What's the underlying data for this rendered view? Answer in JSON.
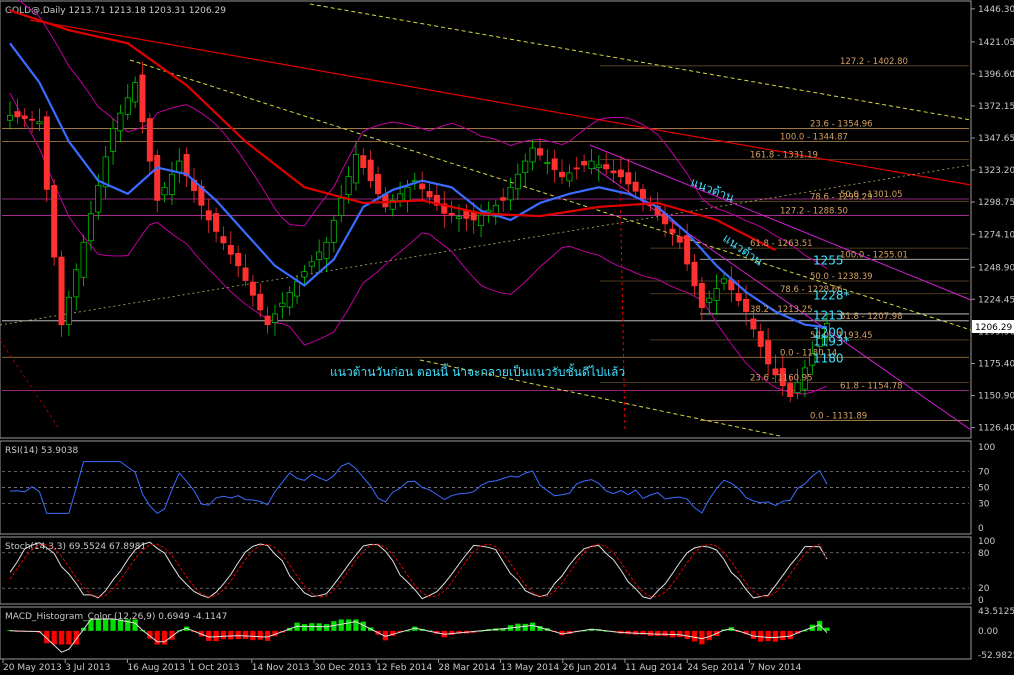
{
  "window": {
    "main_label": "GOLD@,Daily  1213.71 1213.18 1203.31 1206.29",
    "rsi_label": "RSI(14) 53.9038",
    "stoch_label": "Stoch(14,3,3) 69.5524 67.8981",
    "macd_label": "MACD_Histogram_Color (12,26,9) 0.6949 -4.1147"
  },
  "colors": {
    "background": "#000000",
    "axis": "#9a9a9a",
    "text": "#c8c8c8",
    "candle_up": "#00d000",
    "candle_down": "#ff3030",
    "ma_blue": "#3a6cff",
    "ma_red": "#e00000",
    "bollinger": "#c000a0",
    "fib_orange": "#d4a060",
    "trend_yellow": "#d8d840",
    "annotation_cyan": "#40e0ff",
    "hist_pos": "#00e000",
    "hist_neg": "#ff0000"
  },
  "chart_data": {
    "type": "line",
    "title": "GOLD@,Daily",
    "price_axis_ticks": [
      "1446.30",
      "1421.05",
      "1396.60",
      "1372.15",
      "1347.65",
      "1323.20",
      "1298.75",
      "1274.10",
      "1248.90",
      "1224.45",
      "1199.90",
      "1175.40",
      "1150.90",
      "1126.40"
    ],
    "current_price": "1206.29",
    "ylim": [
      1120,
      1450
    ],
    "x_dates": [
      "20 May 2013",
      "3 Jul 2013",
      "16 Aug 2013",
      "1 Oct 2013",
      "14 Nov 2013",
      "30 Dec 2013",
      "12 Feb 2014",
      "28 Mar 2014",
      "13 May 2014",
      "26 Jun 2014",
      "11 Aug 2014",
      "24 Sep 2014",
      "7 Nov 2014"
    ],
    "close_path": [
      {
        "x": 0,
        "y": 1365
      },
      {
        "x": 4,
        "y": 1360
      },
      {
        "x": 7,
        "y": 1205
      },
      {
        "x": 10,
        "y": 1268
      },
      {
        "x": 14,
        "y": 1355
      },
      {
        "x": 17,
        "y": 1390
      },
      {
        "x": 20,
        "y": 1300
      },
      {
        "x": 23,
        "y": 1330
      },
      {
        "x": 27,
        "y": 1285
      },
      {
        "x": 31,
        "y": 1250
      },
      {
        "x": 35,
        "y": 1205
      },
      {
        "x": 39,
        "y": 1238
      },
      {
        "x": 43,
        "y": 1268
      },
      {
        "x": 47,
        "y": 1335
      },
      {
        "x": 51,
        "y": 1295
      },
      {
        "x": 55,
        "y": 1315
      },
      {
        "x": 59,
        "y": 1290
      },
      {
        "x": 63,
        "y": 1285
      },
      {
        "x": 67,
        "y": 1300
      },
      {
        "x": 71,
        "y": 1340
      },
      {
        "x": 75,
        "y": 1318
      },
      {
        "x": 79,
        "y": 1330
      },
      {
        "x": 83,
        "y": 1318
      },
      {
        "x": 87,
        "y": 1296
      },
      {
        "x": 91,
        "y": 1268
      },
      {
        "x": 94,
        "y": 1218
      },
      {
        "x": 97,
        "y": 1240
      },
      {
        "x": 100,
        "y": 1215
      },
      {
        "x": 103,
        "y": 1175
      },
      {
        "x": 106,
        "y": 1150
      },
      {
        "x": 109,
        "y": 1183
      },
      {
        "x": 111,
        "y": 1206
      }
    ],
    "ma_blue_path": [
      {
        "x": 0,
        "y": 1420
      },
      {
        "x": 4,
        "y": 1390
      },
      {
        "x": 8,
        "y": 1345
      },
      {
        "x": 12,
        "y": 1315
      },
      {
        "x": 16,
        "y": 1305
      },
      {
        "x": 20,
        "y": 1325
      },
      {
        "x": 24,
        "y": 1320
      },
      {
        "x": 28,
        "y": 1300
      },
      {
        "x": 32,
        "y": 1275
      },
      {
        "x": 36,
        "y": 1250
      },
      {
        "x": 40,
        "y": 1235
      },
      {
        "x": 44,
        "y": 1255
      },
      {
        "x": 48,
        "y": 1295
      },
      {
        "x": 52,
        "y": 1308
      },
      {
        "x": 56,
        "y": 1315
      },
      {
        "x": 60,
        "y": 1310
      },
      {
        "x": 64,
        "y": 1292
      },
      {
        "x": 68,
        "y": 1285
      },
      {
        "x": 72,
        "y": 1298
      },
      {
        "x": 76,
        "y": 1305
      },
      {
        "x": 80,
        "y": 1310
      },
      {
        "x": 84,
        "y": 1305
      },
      {
        "x": 88,
        "y": 1295
      },
      {
        "x": 92,
        "y": 1275
      },
      {
        "x": 96,
        "y": 1250
      },
      {
        "x": 100,
        "y": 1230
      },
      {
        "x": 104,
        "y": 1215
      },
      {
        "x": 108,
        "y": 1205
      },
      {
        "x": 111,
        "y": 1203
      }
    ],
    "ma_red_path": [
      {
        "x": 0,
        "y": 1445
      },
      {
        "x": 8,
        "y": 1430
      },
      {
        "x": 16,
        "y": 1420
      },
      {
        "x": 24,
        "y": 1388
      },
      {
        "x": 32,
        "y": 1345
      },
      {
        "x": 40,
        "y": 1310
      },
      {
        "x": 48,
        "y": 1298
      },
      {
        "x": 56,
        "y": 1300
      },
      {
        "x": 64,
        "y": 1290
      },
      {
        "x": 72,
        "y": 1288
      },
      {
        "x": 80,
        "y": 1295
      },
      {
        "x": 88,
        "y": 1298
      },
      {
        "x": 96,
        "y": 1285
      },
      {
        "x": 104,
        "y": 1262
      }
    ],
    "fib_levels": [
      {
        "label": "127.2 - 1402.80",
        "price": 1402.8
      },
      {
        "label": "23.6 - 1354.96",
        "price": 1354.96
      },
      {
        "label": "100.0 - 1344.87",
        "price": 1344.87
      },
      {
        "label": "161.8 - 1331.19",
        "price": 1331.19
      },
      {
        "label": "50.0 - 1301.05",
        "price": 1301.05
      },
      {
        "label": "78.6 - 1299.29",
        "price": 1299.29
      },
      {
        "label": "127.2 - 1288.50",
        "price": 1288.5
      },
      {
        "label": "61.8 - 1263.51",
        "price": 1263.51
      },
      {
        "label": "100.0 - 1255.01",
        "price": 1255.01
      },
      {
        "label": "50.0 - 1238.39",
        "price": 1238.39
      },
      {
        "label": "78.6 - 1228.66",
        "price": 1228.66
      },
      {
        "label": "38.2 - 1213.25",
        "price": 1213.25
      },
      {
        "label": "61.8 - 1207.98",
        "price": 1207.98
      },
      {
        "label": "50.0 - 1193.45",
        "price": 1193.45
      },
      {
        "label": "0.0 - 1180.14",
        "price": 1180.14
      },
      {
        "label": "23.6 - 1160.95",
        "price": 1160.95
      },
      {
        "label": "61.8 - 1154.78",
        "price": 1154.78
      },
      {
        "label": "0.0 - 1131.89",
        "price": 1131.89
      }
    ],
    "level_labels": [
      {
        "text": "1255",
        "price": 1255
      },
      {
        "text": "1228*",
        "price": 1228
      },
      {
        "text": "1213",
        "price": 1213
      },
      {
        "text": "1200",
        "price": 1200
      },
      {
        "text": "1193*",
        "price": 1193
      },
      {
        "text": "1180",
        "price": 1180
      }
    ],
    "annotations": {
      "resistance_1": "แนวต้าน",
      "resistance_2": "แนวต้าน",
      "note": "แนวต้านวันก่อน ตอนนี้ น่าจะกลายเป็นแนวรับชั้นดีไปแล้ว"
    },
    "rsi": {
      "ticks": [
        "100",
        "70",
        "50",
        "30",
        "0"
      ],
      "levels": [
        70,
        50,
        30
      ],
      "value": 53.9038
    },
    "stoch": {
      "ticks": [
        "100",
        "80",
        "20",
        "0"
      ],
      "levels": [
        80,
        20
      ],
      "main": 69.5524,
      "signal": 67.8981
    },
    "macd": {
      "ticks": [
        "43.5125",
        "0.00",
        "-52.9825"
      ],
      "histogram": 0.6949,
      "signal": -4.1147
    }
  }
}
